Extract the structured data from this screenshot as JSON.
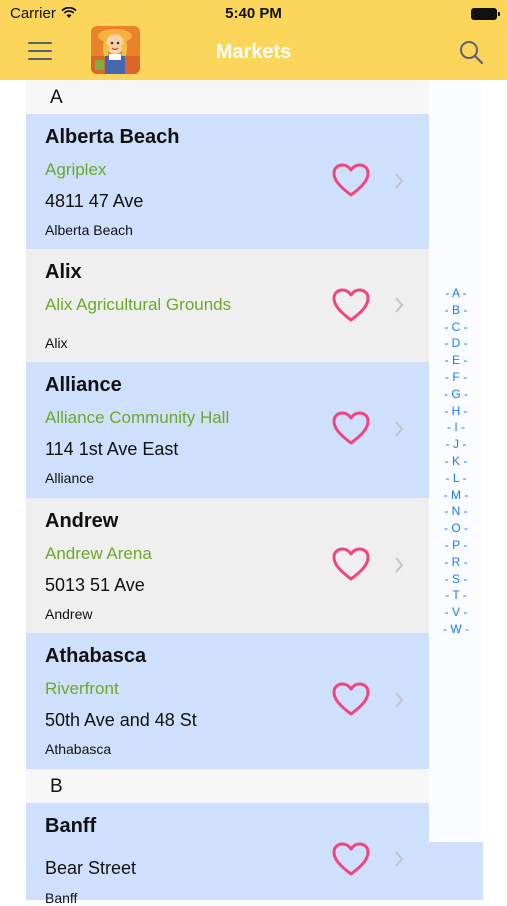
{
  "status_bar": {
    "carrier": "Carrier",
    "time": "5:40 PM"
  },
  "nav": {
    "title": "Markets"
  },
  "sections": [
    {
      "letter": "A"
    },
    {
      "letter": "B"
    }
  ],
  "markets": [
    {
      "town": "Alberta Beach",
      "venue": "Agriplex",
      "address": "4811 47 Ave",
      "city": "Alberta Beach"
    },
    {
      "town": "Alix",
      "venue": "Alix Agricultural Grounds",
      "address": "",
      "city": "Alix"
    },
    {
      "town": "Alliance",
      "venue": "Alliance Community Hall",
      "address": "114 1st Ave East",
      "city": "Alliance"
    },
    {
      "town": "Andrew",
      "venue": "Andrew Arena",
      "address": "5013 51 Ave",
      "city": "Andrew"
    },
    {
      "town": "Athabasca",
      "venue": "Riverfront",
      "address": "50th Ave and 48 St",
      "city": "Athabasca"
    },
    {
      "town": "Banff",
      "venue": "",
      "address": "Bear Street",
      "city": "Banff"
    }
  ],
  "index": [
    "A",
    "B",
    "C",
    "D",
    "E",
    "F",
    "G",
    "H",
    "I",
    "J",
    "K",
    "L",
    "M",
    "N",
    "O",
    "P",
    "R",
    "S",
    "T",
    "V",
    "W"
  ],
  "colors": {
    "nav_background": "#fcd55b",
    "row_blue": "#cfe0fc",
    "row_gray": "#efefef",
    "venue_green": "#6aa92a",
    "heart_pink": "#f2457e",
    "index_blue": "#1a7cf5"
  }
}
